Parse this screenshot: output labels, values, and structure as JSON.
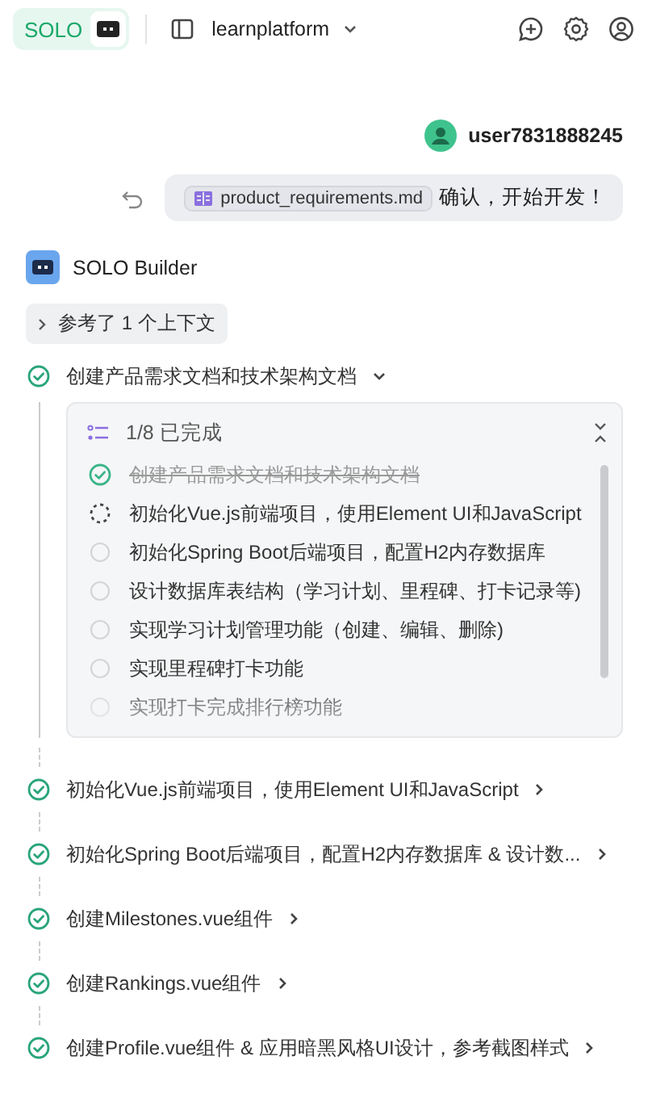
{
  "header": {
    "badge": "SOLO",
    "project": "learnplatform"
  },
  "user": {
    "name": "user7831888245",
    "attachment": "product_requirements.md",
    "text": "确认，开始开发！"
  },
  "assistant": {
    "name": "SOLO Builder",
    "context": "参考了 1 个上下文",
    "steps": [
      {
        "title": "创建产品需求文档和技术架构文档",
        "expanded": true,
        "todo": {
          "summary": "1/8 已完成",
          "items": [
            {
              "text": "创建产品需求文档和技术架构文档",
              "kind": "done"
            },
            {
              "text": "初始化Vue.js前端项目，使用Element UI和JavaScript",
              "kind": "running"
            },
            {
              "text": "初始化Spring Boot后端项目，配置H2内存数据库",
              "kind": "pending"
            },
            {
              "text": "设计数据库表结构（学习计划、里程碑、打卡记录等)",
              "kind": "pending"
            },
            {
              "text": "实现学习计划管理功能（创建、编辑、删除)",
              "kind": "pending"
            },
            {
              "text": "实现里程碑打卡功能",
              "kind": "pending"
            },
            {
              "text": "实现打卡完成排行榜功能",
              "kind": "pending"
            }
          ]
        }
      },
      {
        "title": "初始化Vue.js前端项目，使用Element UI和JavaScript",
        "expanded": false
      },
      {
        "title": "初始化Spring Boot后端项目，配置H2内存数据库 & 设计数...",
        "expanded": false
      },
      {
        "title": "创建Milestones.vue组件",
        "expanded": false
      },
      {
        "title": "创建Rankings.vue组件",
        "expanded": false
      },
      {
        "title": "创建Profile.vue组件 & 应用暗黑风格UI设计，参考截图样式",
        "expanded": false
      }
    ]
  }
}
